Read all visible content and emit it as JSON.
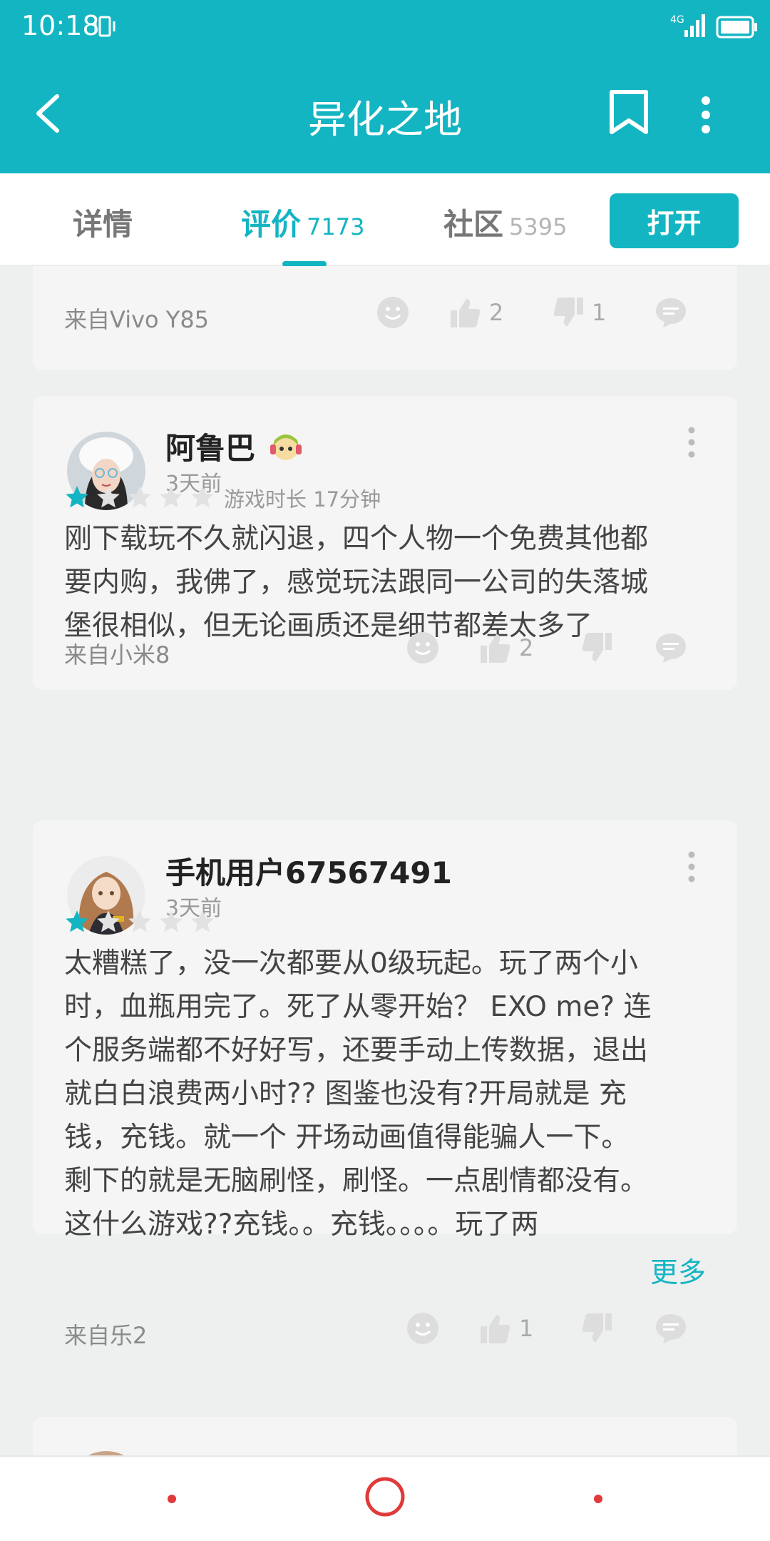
{
  "status": {
    "time": "10:18",
    "network": "4G"
  },
  "appbar": {
    "title": "异化之地"
  },
  "tabs": {
    "details": "详情",
    "reviews": "评价",
    "reviews_count": "7173",
    "community": "社区",
    "community_count": "5395",
    "open_button": "打开"
  },
  "reviews": [
    {
      "device": "来自Vivo Y85",
      "likes": "2",
      "dislikes": "1"
    },
    {
      "username": "阿鲁巴",
      "time": "3天前",
      "rating": 1,
      "playtime": "游戏时长 17分钟",
      "lines": [
        "刚下载玩不久就闪退，四个人物一个免费其他都",
        "要内购，我佛了，感觉玩法跟同一公司的失落城",
        "堡很相似，但无论画质还是细节都差太多了"
      ],
      "device": "来自小米8",
      "likes": "2"
    },
    {
      "username": "手机用户67567491",
      "time": "3天前",
      "rating": 1,
      "lines": [
        "太糟糕了，没一次都要从0级玩起。玩了两个小",
        "时，血瓶用完了。死了从零开始？ EXO me? 连",
        "个服务端都不好好写，还要手动上传数据，退出",
        "就白白浪费两小时?? 图鉴也没有?开局就是 充",
        "钱，充钱。就一个 开场动画值得能骗人一下。",
        "剩下的就是无脑刷怪，刷怪。一点剧情都没有。",
        "这什么游戏??充钱。。充钱。。。。玩了两"
      ],
      "more": "更多",
      "device": "来自乐2",
      "likes": "1"
    }
  ],
  "colors": {
    "accent": "#14b5c2",
    "star_empty": "#e2e2e2",
    "nav_red": "#e03a3a"
  }
}
